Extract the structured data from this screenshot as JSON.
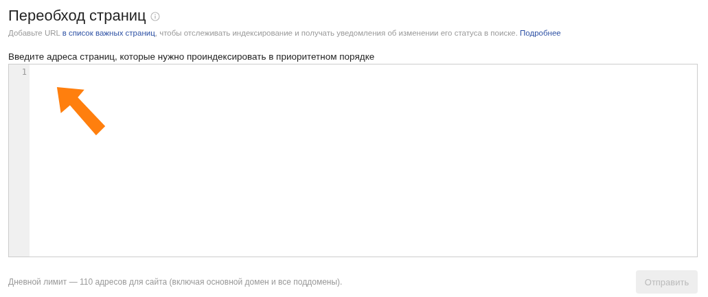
{
  "title": "Переобход страниц",
  "intro": {
    "before": "Добавьте URL ",
    "link": "в список важных страниц",
    "middle": ", чтобы отслеживать индексирование и получать уведомления об изменении его статуса в поиске. ",
    "more": "Подробнее"
  },
  "editor": {
    "label": "Введите адреса страниц, которые нужно проиндексировать в приоритетном порядке",
    "line_numbers": [
      "1"
    ]
  },
  "footer": {
    "note": "Дневной лимит — 110 адресов для сайта (включая основной домен и все поддомены).",
    "submit": {
      "label": "Отправить",
      "disabled": true
    }
  }
}
